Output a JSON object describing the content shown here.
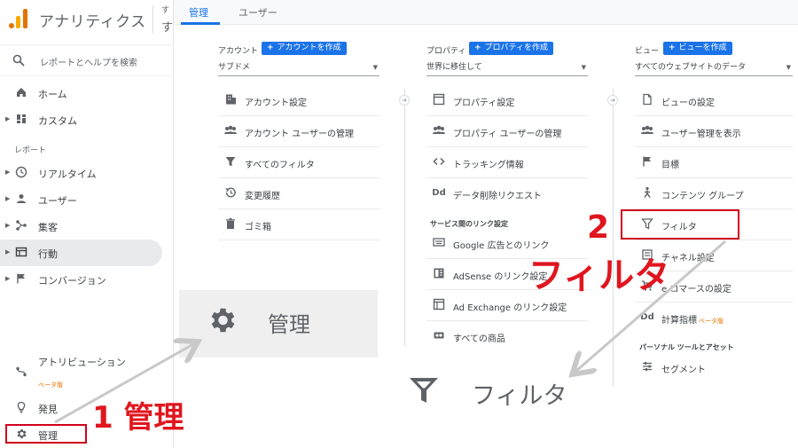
{
  "app": {
    "title": "アナリティクス",
    "account_mini_top": "す",
    "account_mini_bottom": "す"
  },
  "sidebar": {
    "search_placeholder": "レポートとヘルプを検索",
    "items_top": [
      {
        "label": "ホーム",
        "icon": "home-icon"
      },
      {
        "label": "カスタム",
        "icon": "dashboard-icon"
      }
    ],
    "section_label": "レポート",
    "reports": [
      {
        "label": "リアルタイム",
        "icon": "clock-icon"
      },
      {
        "label": "ユーザー",
        "icon": "person-icon"
      },
      {
        "label": "集客",
        "icon": "acquisition-icon"
      },
      {
        "label": "行動",
        "icon": "behavior-icon"
      },
      {
        "label": "コンバージョン",
        "icon": "flag-icon"
      }
    ],
    "bottom": [
      {
        "label": "アトリビューション",
        "badge": "ベータ版",
        "icon": "attribution-icon"
      },
      {
        "label": "発見",
        "icon": "lightbulb-icon"
      },
      {
        "label": "管理",
        "icon": "gear-icon"
      }
    ]
  },
  "tabs": [
    {
      "label": "管理"
    },
    {
      "label": "ユーザー"
    }
  ],
  "account_col": {
    "header": "アカウント",
    "create_label": "アカウントを作成",
    "selected": "サブドメ",
    "items": [
      {
        "label": "アカウント設定",
        "icon": "building-icon"
      },
      {
        "label": "アカウント ユーザーの管理",
        "icon": "people-icon"
      },
      {
        "label": "すべてのフィルタ",
        "icon": "filter-icon"
      },
      {
        "label": "変更履歴",
        "icon": "history-icon"
      },
      {
        "label": "ゴミ箱",
        "icon": "trash-icon"
      }
    ]
  },
  "property_col": {
    "header": "プロパティ",
    "create_label": "プロパティを作成",
    "selected": "世界に移住して",
    "items": [
      {
        "label": "プロパティ設定",
        "icon": "window-icon"
      },
      {
        "label": "プロパティ ユーザーの管理",
        "icon": "people-icon"
      },
      {
        "label": "トラッキング情報",
        "icon": "code-icon"
      },
      {
        "label": "データ削除リクエスト",
        "icon": "dd-icon"
      }
    ],
    "links_section": "サービス間のリンク設定",
    "links": [
      {
        "label": "Google 広告とのリンク",
        "icon": "keyboard-icon"
      },
      {
        "label": "AdSense のリンク設定",
        "icon": "adsense-icon"
      },
      {
        "label": "Ad Exchange のリンク設定",
        "icon": "window-icon"
      },
      {
        "label": "すべての商品",
        "icon": "link-icon"
      }
    ]
  },
  "view_col": {
    "header": "ビュー",
    "create_label": "ビューを作成",
    "selected": "すべてのウェブサイトのデータ",
    "items": [
      {
        "label": "ビューの設定",
        "icon": "document-icon"
      },
      {
        "label": "ユーザー管理を表示",
        "icon": "people-icon"
      },
      {
        "label": "目標",
        "icon": "flag-icon"
      },
      {
        "label": "コンテンツ グループ",
        "icon": "walk-icon"
      },
      {
        "label": "フィルタ",
        "icon": "filter-icon"
      },
      {
        "label": "チャネル設定",
        "icon": "channel-icon"
      },
      {
        "label": "e コマースの設定",
        "icon": "cart-icon"
      },
      {
        "label": "計算指標",
        "badge": "ベータ版",
        "icon": "dd-icon"
      }
    ],
    "tools_section": "パーソナル ツールとアセット",
    "tools": [
      {
        "label": "セグメント",
        "icon": "segment-icon"
      }
    ]
  },
  "zoom_admin": {
    "label": "管理"
  },
  "zoom_filter": {
    "label": "フィルタ"
  },
  "annotations": {
    "step1": "1 管理",
    "step2_num": "2",
    "step2_word": "フィルタ"
  },
  "colors": {
    "accent": "#1a73e8",
    "annotation": "#e0161e",
    "brand_orange": "#e37400"
  }
}
